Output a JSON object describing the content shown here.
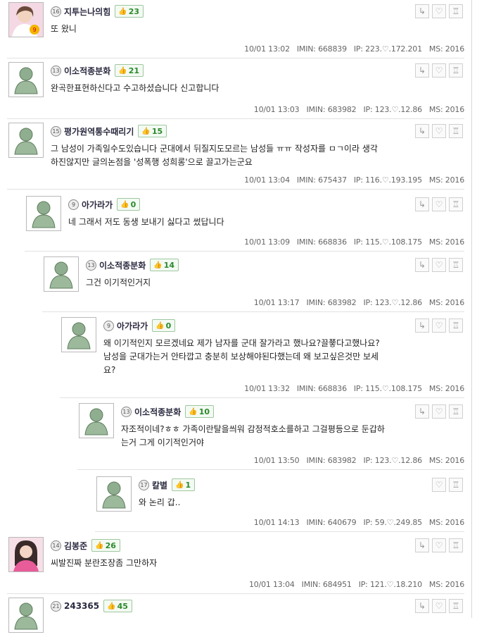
{
  "comments": [
    {
      "nick": "지투는나의힘",
      "level": "16",
      "likes": "23",
      "avatar": "photo-pink",
      "text": "또 왔니",
      "time": "10/01 13:02",
      "imin": "IMIN: 668839",
      "ip": "IP: 223.♡.172.201",
      "ms": "MS: 2016"
    },
    {
      "nick": "이소적종분화",
      "level": "13",
      "likes": "21",
      "avatar": "default-user",
      "text": "완곡한표현하신다고 수고하셨습니다 신고합니다",
      "time": "10/01 13:03",
      "imin": "IMIN: 683982",
      "ip": "IP: 123.♡.12.86",
      "ms": "MS: 2016"
    },
    {
      "nick": "평가원역통수때리기",
      "level": "15",
      "likes": "15",
      "avatar": "default-user",
      "text": "그 남성이 가족일수도있습니다 군대에서 뒤질지도모르는 남성들 ㅠㅠ 작성자를 ㅁㄱ이라 생각\n하진않지만 글의논점을 '성폭행 성희롱'으로 끌고가는군요",
      "time": "10/01 13:04",
      "imin": "IMIN: 675437",
      "ip": "IP: 116.♡.193.195",
      "ms": "MS: 2016"
    },
    {
      "nick": "아가라가",
      "level": "9",
      "likes": "0",
      "avatar": "default-user",
      "text": "네 그래서 저도 동생 보내기 싫다고 썼답니다",
      "time": "10/01 13:09",
      "imin": "IMIN: 668836",
      "ip": "IP: 115.♡.108.175",
      "ms": "MS: 2016"
    },
    {
      "nick": "이소적종분화",
      "level": "13",
      "likes": "14",
      "avatar": "default-user",
      "text": "그건 이기적인거지",
      "time": "10/01 13:17",
      "imin": "IMIN: 683982",
      "ip": "IP: 123.♡.12.86",
      "ms": "MS: 2016"
    },
    {
      "nick": "아가라가",
      "level": "9",
      "likes": "0",
      "avatar": "default-user",
      "text": "왜 이기적인지 모르겠네요 제가 남자를 군대 잘가라고 했나요?끌쭇다고했나요?\n남성을 군대가는거 안타깝고 충분히 보상해야된다했는데 왜 보고싶은것만 보세\n요?",
      "time": "10/01 13:32",
      "imin": "IMIN: 668836",
      "ip": "IP: 115.♡.108.175",
      "ms": "MS: 2016"
    },
    {
      "nick": "이소적종분화",
      "level": "13",
      "likes": "10",
      "avatar": "default-user",
      "text": "자조적이네?ㅎㅎ 가족이란탈을씌워 감정적호소를하고 그걸평등으로 둔갑하\n는거 그게 이기적인거야",
      "time": "10/01 13:50",
      "imin": "IMIN: 683982",
      "ip": "IP: 123.♡.12.86",
      "ms": "MS: 2016"
    },
    {
      "nick": "칼별",
      "level": "17",
      "likes": "1",
      "avatar": "default-user",
      "text": "와 논리 갑..",
      "time": "10/01 14:13",
      "imin": "IMIN: 640679",
      "ip": "IP: 59.♡.249.85",
      "ms": "MS: 2016"
    },
    {
      "nick": "김봉준",
      "level": "14",
      "likes": "26",
      "avatar": "photo-girl",
      "text": "씨발진짜 분란조장좀 그만하자",
      "time": "10/01 13:04",
      "imin": "IMIN: 684951",
      "ip": "IP: 121.♡.18.210",
      "ms": "MS: 2016"
    },
    {
      "nick": "243365",
      "level": "21",
      "likes": "45",
      "avatar": "default-user",
      "text": "",
      "time": "",
      "imin": "",
      "ip": "",
      "ms": ""
    }
  ]
}
